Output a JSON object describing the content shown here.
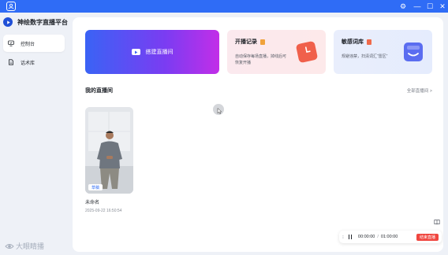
{
  "titlebar": {
    "controls": {
      "settings": "⚙",
      "minimize": "—",
      "maximize": "☐",
      "close": "✕"
    }
  },
  "sidebar": {
    "app_name": "神绘数字直播平台",
    "items": [
      {
        "label": "控制台",
        "icon": "monitor-icon",
        "active": true
      },
      {
        "label": "话术库",
        "icon": "document-icon",
        "active": false
      }
    ]
  },
  "cards": {
    "start_live": {
      "label": "搭建直播间",
      "icon": "play-icon"
    },
    "record": {
      "title": "开播记录",
      "desc": "自动保存每场直播，掉线后可恢复开播",
      "tag_color": "#f0a23b"
    },
    "words": {
      "title": "敏感词库",
      "desc": "规避违禁，扫清词汇“雷区”",
      "tag_color": "#f06a4b"
    }
  },
  "section": {
    "title": "我的直播间",
    "link": "全部直播间 >"
  },
  "room": {
    "badge": "草稿",
    "name": "未命名",
    "time": "2025-09-22 16:50:54"
  },
  "player": {
    "current": "00:00:00",
    "separator": "/",
    "total": "01:00:00",
    "end_label": "结束直播"
  },
  "watermark": {
    "text": "大眼睛播"
  },
  "colors": {
    "accent": "#2f6cf6",
    "danger": "#f0463f"
  }
}
